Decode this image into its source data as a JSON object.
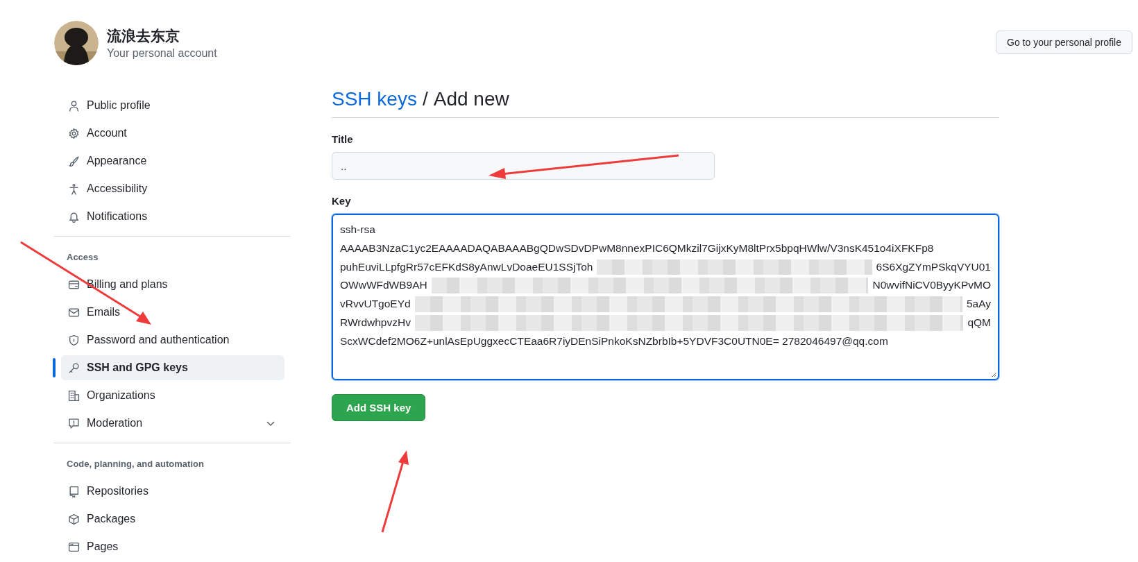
{
  "header": {
    "name": "流浪去东京",
    "subtitle": "Your personal account",
    "profile_button": "Go to your personal profile"
  },
  "sidebar": {
    "groups": [
      {
        "items": [
          {
            "label": "Public profile",
            "selected": false
          },
          {
            "label": "Account",
            "selected": false
          },
          {
            "label": "Appearance",
            "selected": false
          },
          {
            "label": "Accessibility",
            "selected": false
          },
          {
            "label": "Notifications",
            "selected": false
          }
        ]
      },
      {
        "heading": "Access",
        "items": [
          {
            "label": "Billing and plans",
            "selected": false
          },
          {
            "label": "Emails",
            "selected": false
          },
          {
            "label": "Password and authentication",
            "selected": false
          },
          {
            "label": "SSH and GPG keys",
            "selected": true
          },
          {
            "label": "Organizations",
            "selected": false
          },
          {
            "label": "Moderation",
            "selected": false,
            "expanded": false
          }
        ]
      },
      {
        "heading": "Code, planning, and automation",
        "items": [
          {
            "label": "Repositories",
            "selected": false
          },
          {
            "label": "Packages",
            "selected": false
          },
          {
            "label": "Pages",
            "selected": false
          }
        ]
      }
    ]
  },
  "breadcrumb": {
    "link": "SSH keys",
    "separator": "/",
    "current": "Add new"
  },
  "form": {
    "title_label": "Title",
    "title_value": "..",
    "key_label": "Key",
    "key_lines": [
      {
        "start": "ssh-rsa"
      },
      {
        "start": "AAAAB3NzaC1yc2EAAAADAQABAAABgQDwSDvDPwM8nnexPIC6QMkzil7GijxKyM8ltPrx5bpqHWlw/V3nsK451o4iXFKFp8"
      },
      {
        "start": "puhEuviLLpfgRr57cEFKdS8yAnwLvDoaeEU1SSjToh",
        "end": "6S6XgZYmPSkqVYU01"
      },
      {
        "start": "OWwWFdWB9AH",
        "end": "N0wvifNiCV0ByyKPvMO"
      },
      {
        "start": "vRvvUTgoEYd",
        "end": "5aAy"
      },
      {
        "start": "RWrdwhpvzHv",
        "end": "qQM"
      },
      {
        "start": "ScxWCdef2MO6Z+unlAsEpUggxecCTEaa6R7iyDEnSiPnkoKsNZbrbIb+5YDVF3C0UTN0E= 2782046497@qq.com"
      }
    ],
    "submit": "Add SSH key"
  }
}
